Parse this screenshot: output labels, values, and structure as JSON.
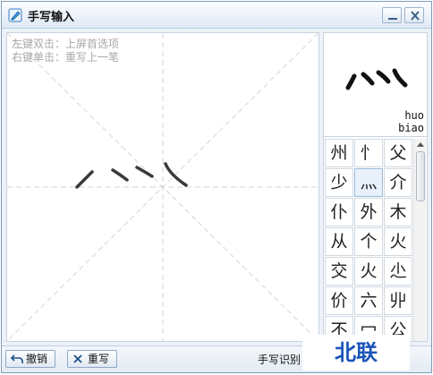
{
  "window": {
    "title": "手写输入",
    "minimize_icon": "minimize-icon",
    "close_icon": "close-icon"
  },
  "canvas": {
    "hint_line1": "左键双击：上屏首选项",
    "hint_line2": "右键单击：重写上一笔"
  },
  "preview": {
    "pinyin_line1": "huo",
    "pinyin_line2": "biao"
  },
  "candidates": [
    "州",
    "忄",
    "父",
    "少",
    "灬",
    "介",
    "仆",
    "外",
    "木",
    "从",
    "个",
    "火",
    "交",
    "火",
    "尐",
    "价",
    "六",
    "丱",
    "不",
    "冖",
    "公"
  ],
  "selected_candidate_index": 4,
  "toolbar": {
    "undo_label": "撤销",
    "rewrite_label": "重写",
    "status_text": "手写识别"
  },
  "watermark": "北联"
}
